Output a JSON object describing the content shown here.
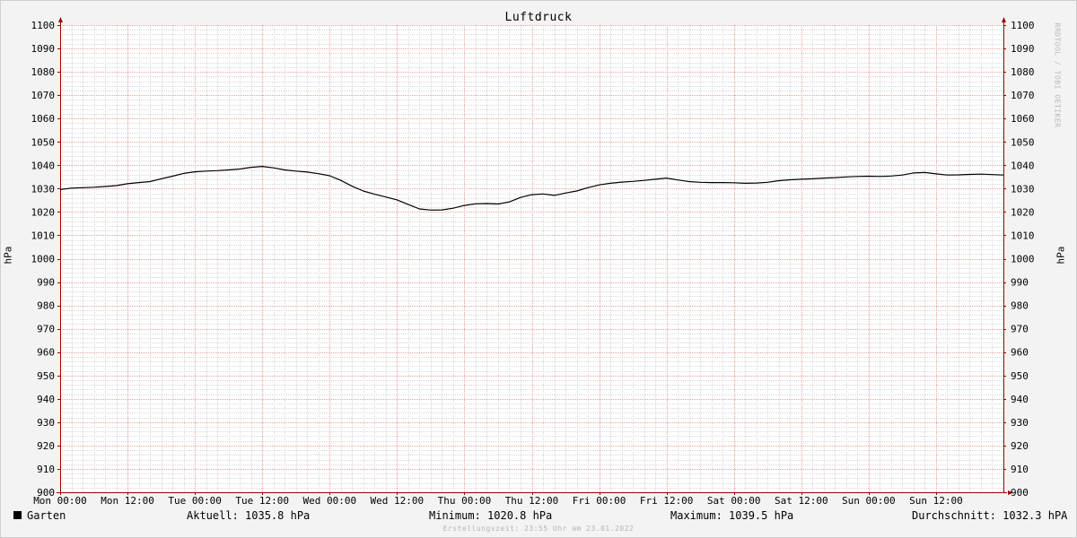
{
  "chart_data": {
    "type": "line",
    "title": "Luftdruck",
    "ylabel": "hPa",
    "ylim": [
      900,
      1100
    ],
    "y_ticks": [
      900,
      910,
      920,
      930,
      940,
      950,
      960,
      970,
      980,
      990,
      1000,
      1010,
      1020,
      1030,
      1040,
      1050,
      1060,
      1070,
      1080,
      1090,
      1100
    ],
    "x_ticks": [
      "Mon 00:00",
      "Mon 12:00",
      "Tue 00:00",
      "Tue 12:00",
      "Wed 00:00",
      "Wed 12:00",
      "Thu 00:00",
      "Thu 12:00",
      "Fri 00:00",
      "Fri 12:00",
      "Sat 00:00",
      "Sat 12:00",
      "Sun 00:00",
      "Sun 12:00"
    ],
    "x_unit": "hours since Mon 00:00",
    "xlim": [
      0,
      168
    ],
    "grid": true,
    "series": [
      {
        "name": "Garten",
        "color": "#000000",
        "x": [
          0,
          2,
          4,
          6,
          8,
          10,
          12,
          14,
          16,
          18,
          20,
          22,
          24,
          26,
          28,
          30,
          32,
          34,
          36,
          38,
          40,
          42,
          44,
          46,
          48,
          50,
          52,
          54,
          56,
          58,
          60,
          62,
          64,
          66,
          68,
          70,
          72,
          74,
          76,
          78,
          80,
          82,
          84,
          86,
          88,
          90,
          92,
          94,
          96,
          98,
          100,
          102,
          104,
          106,
          108,
          110,
          112,
          114,
          116,
          118,
          120,
          122,
          124,
          126,
          128,
          130,
          132,
          134,
          136,
          138,
          140,
          142,
          144,
          146,
          148,
          150,
          152,
          154,
          156,
          158,
          160,
          162,
          164,
          166,
          168
        ],
        "values": [
          1029.6,
          1030.2,
          1030.4,
          1030.6,
          1030.9,
          1031.3,
          1032.1,
          1032.6,
          1033.0,
          1034.2,
          1035.3,
          1036.5,
          1037.2,
          1037.5,
          1037.7,
          1038.0,
          1038.4,
          1039.1,
          1039.5,
          1038.9,
          1038.0,
          1037.5,
          1037.1,
          1036.4,
          1035.5,
          1033.5,
          1031.0,
          1029.0,
          1027.6,
          1026.4,
          1025.2,
          1023.2,
          1021.3,
          1020.8,
          1020.9,
          1021.6,
          1022.8,
          1023.5,
          1023.6,
          1023.4,
          1024.3,
          1026.2,
          1027.4,
          1027.7,
          1027.1,
          1028.1,
          1029.0,
          1030.4,
          1031.6,
          1032.3,
          1032.8,
          1033.1,
          1033.5,
          1034.0,
          1034.5,
          1033.7,
          1033.0,
          1032.7,
          1032.6,
          1032.6,
          1032.5,
          1032.3,
          1032.4,
          1032.7,
          1033.4,
          1033.8,
          1034.0,
          1034.2,
          1034.5,
          1034.7,
          1035.0,
          1035.2,
          1035.3,
          1035.2,
          1035.4,
          1035.8,
          1036.7,
          1036.9,
          1036.3,
          1035.8,
          1035.9,
          1036.1,
          1036.2,
          1036.0,
          1035.8
        ]
      }
    ]
  },
  "legend": {
    "series_name": "Garten",
    "aktuell": "Aktuell: 1035.8 hPa",
    "minimum": "Minimum: 1020.8 hPa",
    "maximum": "Maximum: 1039.5 hPa",
    "durchschnitt": "Durchschnitt: 1032.3 hPA"
  },
  "watermark": "RRDTOOL / TOBI OETIKER",
  "footer": "Erstellungszeit: 23:55 Uhr am 23.01.2022",
  "colors": {
    "background": "#f3f3f3",
    "plot_background": "#ffffff",
    "major_grid": "#e8a0a0",
    "minor_grid": "#d8d8d8",
    "line": "#000000",
    "axis_arrow": "#a00000"
  }
}
